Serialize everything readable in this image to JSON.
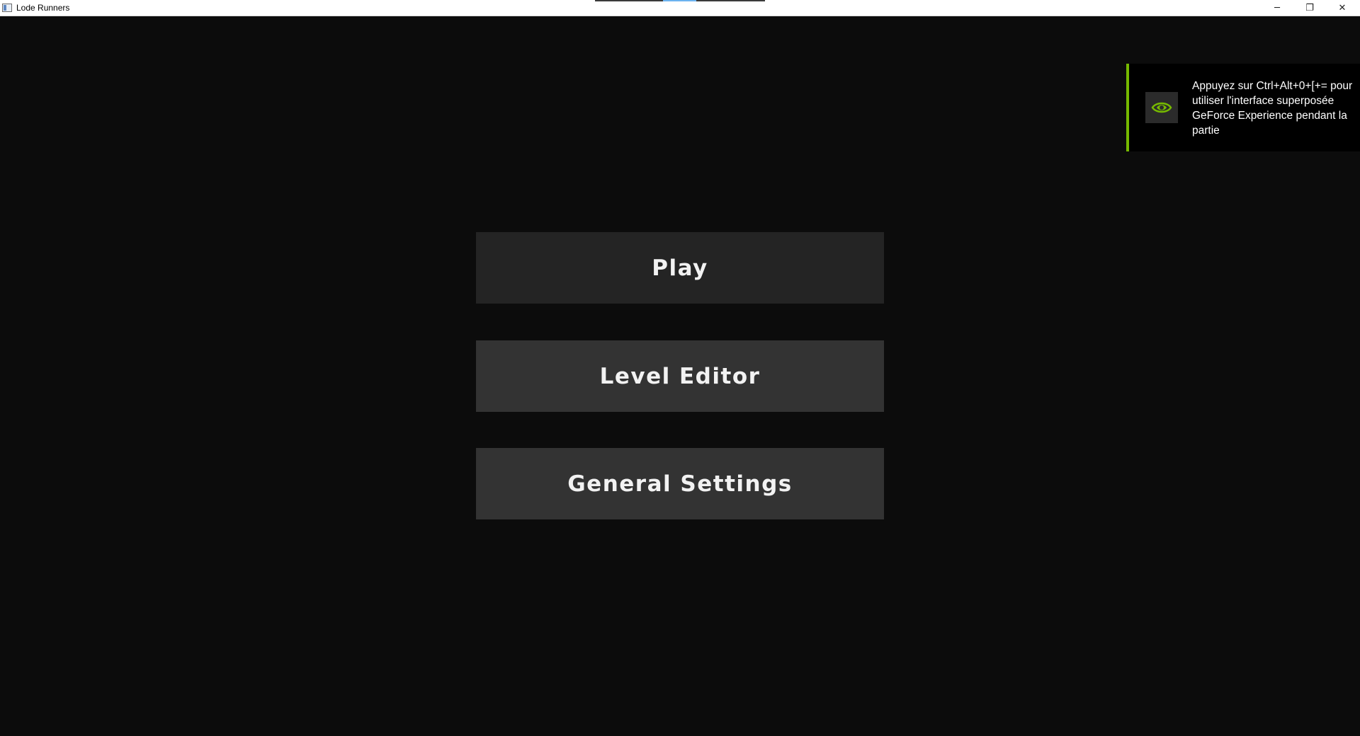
{
  "window": {
    "title": "Lode Runners",
    "controls": {
      "minimize": "─",
      "maximize": "❐",
      "close": "✕"
    }
  },
  "menu": {
    "play_label": "Play",
    "level_editor_label": "Level Editor",
    "general_settings_label": "General Settings"
  },
  "notification": {
    "icon": "nvidia-eye-icon",
    "accent_color": "#76b900",
    "message": "Appuyez sur Ctrl+Alt+0+[+= pour utiliser l'interface superposée GeForce Experience pendant la partie"
  }
}
